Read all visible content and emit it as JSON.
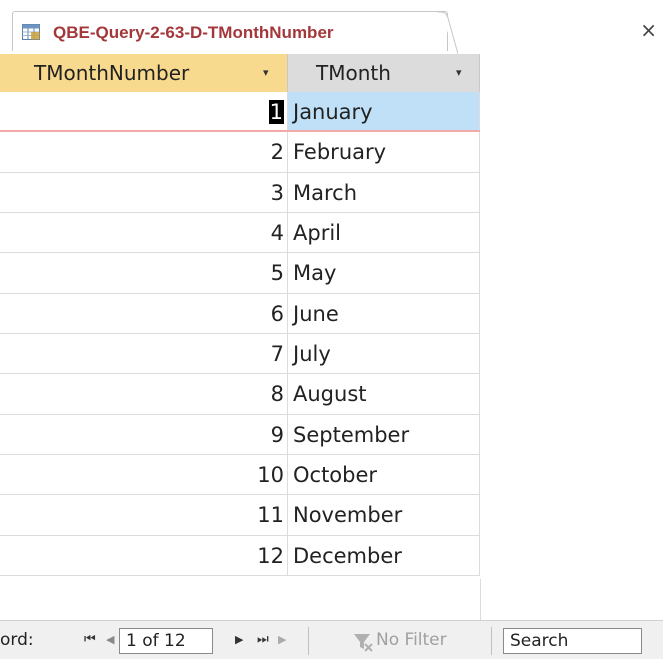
{
  "tab": {
    "title": "QBE-Query-2-63-D-TMonthNumber",
    "icon": "query-icon",
    "close_glyph": "×"
  },
  "columns": [
    {
      "label": "TMonthNumber",
      "arrow": "▾"
    },
    {
      "label": "TMonth",
      "arrow": "▾"
    }
  ],
  "rows": [
    {
      "num": "1",
      "month": "January"
    },
    {
      "num": "2",
      "month": "February"
    },
    {
      "num": "3",
      "month": "March"
    },
    {
      "num": "4",
      "month": "April"
    },
    {
      "num": "5",
      "month": "May"
    },
    {
      "num": "6",
      "month": "June"
    },
    {
      "num": "7",
      "month": "July"
    },
    {
      "num": "8",
      "month": "August"
    },
    {
      "num": "9",
      "month": "September"
    },
    {
      "num": "10",
      "month": "October"
    },
    {
      "num": "11",
      "month": "November"
    },
    {
      "num": "12",
      "month": "December"
    }
  ],
  "navigator": {
    "label": "ord:",
    "first_glyph": "⏮",
    "prev_glyph": "◀",
    "current": "1 of 12",
    "next_glyph": "▶",
    "last_glyph": "⏭",
    "new_glyph": "▶",
    "filter_label": "No Filter",
    "search_label": "Search"
  },
  "colors": {
    "tab_title": "#a4373a",
    "sorted_header": "#f8da8e",
    "header": "#dcdcdc",
    "selected_cell": "#bfe0f7"
  }
}
